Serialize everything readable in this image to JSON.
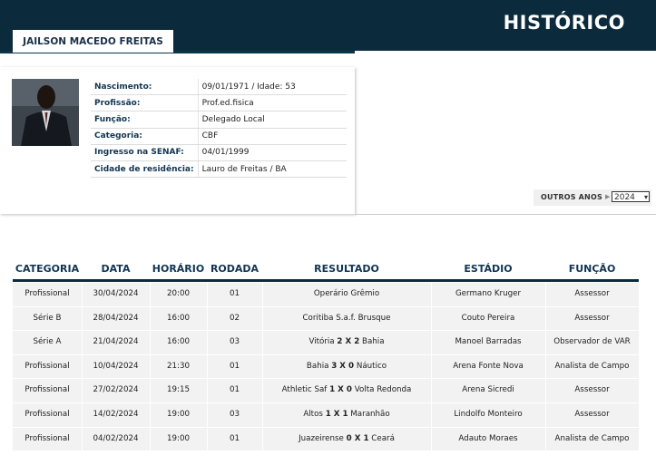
{
  "header": {
    "title": "HISTÓRICO"
  },
  "profile": {
    "name": "JAILSON MACEDO FREITAS",
    "photo_icon": "person-photo",
    "fields": [
      {
        "label": "Nascimento:",
        "value": "09/01/1971 / Idade: 53"
      },
      {
        "label": "Profissão:",
        "value": "Prof.ed.fisica"
      },
      {
        "label": "Função:",
        "value": "Delegado Local"
      },
      {
        "label": "Categoria:",
        "value": "CBF"
      },
      {
        "label": "Ingresso na SENAF:",
        "value": "04/01/1999"
      },
      {
        "label": "Cidade de residência:",
        "value": "Lauro de Freitas / BA"
      }
    ]
  },
  "filter": {
    "label": "OUTROS ANOS",
    "selected_year": "2024"
  },
  "table": {
    "headers": [
      "CATEGORIA",
      "DATA",
      "HORÁRIO",
      "RODADA",
      "RESULTADO",
      "ESTÁDIO",
      "FUNÇÃO"
    ],
    "rows": [
      {
        "categoria": "Profissional",
        "data": "30/04/2024",
        "horario": "20:00",
        "rodada": "01",
        "home": "Operário Grêmio",
        "score": "",
        "away": "",
        "estadio": "Germano Kruger",
        "funcao": "Assessor"
      },
      {
        "categoria": "Série B",
        "data": "28/04/2024",
        "horario": "16:00",
        "rodada": "02",
        "home": "Coritiba S.a.f. Brusque",
        "score": "",
        "away": "",
        "estadio": "Couto Pereira",
        "funcao": "Assessor"
      },
      {
        "categoria": "Série A",
        "data": "21/04/2024",
        "horario": "16:00",
        "rodada": "03",
        "home": "Vitória",
        "score": "2 X 2",
        "away": "Bahia",
        "estadio": "Manoel Barradas",
        "funcao": "Observador de VAR"
      },
      {
        "categoria": "Profissional",
        "data": "10/04/2024",
        "horario": "21:30",
        "rodada": "01",
        "home": "Bahia",
        "score": "3 X 0",
        "away": "Náutico",
        "estadio": "Arena Fonte Nova",
        "funcao": "Analista de Campo"
      },
      {
        "categoria": "Profissional",
        "data": "27/02/2024",
        "horario": "19:15",
        "rodada": "01",
        "home": "Athletic Saf",
        "score": "1 X 0",
        "away": "Volta Redonda",
        "estadio": "Arena Sicredi",
        "funcao": "Assessor"
      },
      {
        "categoria": "Profissional",
        "data": "14/02/2024",
        "horario": "19:00",
        "rodada": "03",
        "home": "Altos",
        "score": "1 X 1",
        "away": "Maranhão",
        "estadio": "Lindolfo Monteiro",
        "funcao": "Assessor"
      },
      {
        "categoria": "Profissional",
        "data": "04/02/2024",
        "horario": "19:00",
        "rodada": "01",
        "home": "Juazeirense",
        "score": "0 X 1",
        "away": "Ceará",
        "estadio": "Adauto Moraes",
        "funcao": "Analista de Campo"
      }
    ]
  },
  "colors": {
    "header_bg": "#0b2a3b",
    "heading_text": "#123552",
    "row_bg": "#f2f2f2"
  }
}
